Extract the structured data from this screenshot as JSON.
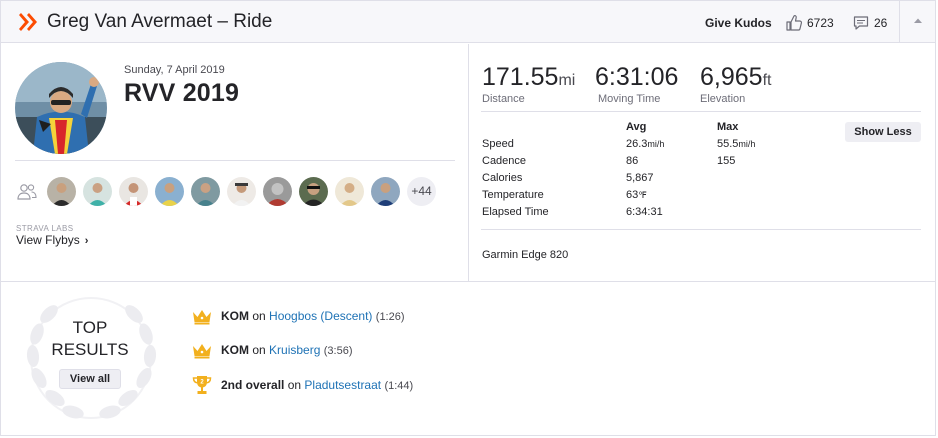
{
  "header": {
    "title": "Greg Van Avermaet – Ride",
    "give_kudos_label": "Give Kudos",
    "kudos_count": "6723",
    "comment_count": "26",
    "brand_color": "#fc4c02"
  },
  "activity": {
    "date": "Sunday, 7 April 2019",
    "title": "RVV 2019"
  },
  "athletes": {
    "more_label": "+44"
  },
  "flybys": {
    "labs_label": "STRAVA LABS",
    "label": "View Flybys"
  },
  "stats": {
    "distance": {
      "value": "171.55",
      "unit": "mi",
      "label": "Distance"
    },
    "moving_time": {
      "value": "6:31:06",
      "unit": "",
      "label": "Moving Time"
    },
    "elevation": {
      "value": "6,965",
      "unit": "ft",
      "label": "Elevation"
    }
  },
  "details": {
    "headers": {
      "avg": "Avg",
      "max": "Max"
    },
    "rows": [
      {
        "label": "Speed",
        "avg": "26.3",
        "avg_unit": "mi/h",
        "max": "55.5",
        "max_unit": "mi/h"
      },
      {
        "label": "Cadence",
        "avg": "86",
        "avg_unit": "",
        "max": "155",
        "max_unit": ""
      },
      {
        "label": "Calories",
        "avg": "5,867",
        "avg_unit": "",
        "max": "",
        "max_unit": ""
      },
      {
        "label": "Temperature",
        "avg": "63",
        "avg_unit": "℉",
        "max": "",
        "max_unit": ""
      },
      {
        "label": "Elapsed Time",
        "avg": "6:34:31",
        "avg_unit": "",
        "max": "",
        "max_unit": ""
      }
    ],
    "show_less_label": "Show Less",
    "device": "Garmin Edge 820"
  },
  "top_results": {
    "title_line1": "TOP",
    "title_line2": "RESULTS",
    "view_all_label": "View all",
    "achievements": [
      {
        "icon": "crown-icon",
        "type": "KOM",
        "on": "on",
        "segment": "Hoogbos (Descent)",
        "time": "(1:26)"
      },
      {
        "icon": "crown-icon",
        "type": "KOM",
        "on": "on",
        "segment": "Kruisberg",
        "time": "(3:56)"
      },
      {
        "icon": "trophy-icon",
        "type": "2nd overall",
        "on": "on",
        "segment": "Pladutsestraat",
        "time": "(1:44)"
      }
    ]
  }
}
